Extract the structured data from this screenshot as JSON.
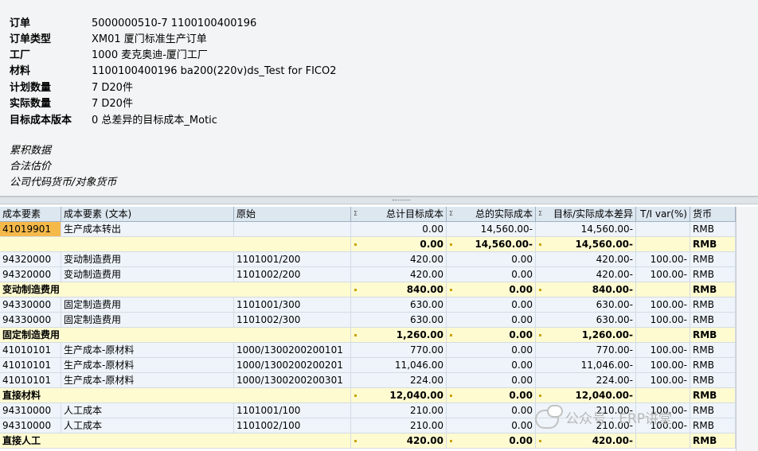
{
  "order_info": {
    "rows": [
      {
        "label": "订单",
        "value": "5000000510-7 1100100400196"
      },
      {
        "label": "订单类型",
        "value": "XM01 厦门标准生产订单"
      },
      {
        "label": "工厂",
        "value": "1000 麦克奥迪-厦门工厂"
      },
      {
        "label": "材料",
        "value": "1100100400196 ba200(220v)ds_Test for FICO2"
      },
      {
        "label": "计划数量",
        "value": "7 D20件"
      },
      {
        "label": "实际数量",
        "value": "7 D20件"
      },
      {
        "label": "目标成本版本",
        "value": "0 总差异的目标成本_Motic"
      }
    ],
    "notes": [
      "累积数据",
      "合法估价",
      "公司代码货币/对象货币"
    ]
  },
  "table": {
    "columns": [
      "成本要素",
      "成本要素 (文本)",
      "原始",
      "总计目标成本",
      "总的实际成本",
      "目标/实际成本差异",
      "T/I var(%)",
      "货币"
    ],
    "rows": [
      {
        "type": "detail",
        "selected": true,
        "cells": [
          "41019901",
          "生产成本转出",
          "",
          "0.00",
          "14,560.00-",
          "14,560.00-",
          "",
          "RMB"
        ]
      },
      {
        "type": "total",
        "cells": [
          "",
          "",
          "",
          "0.00",
          "14,560.00-",
          "14,560.00-",
          "",
          "RMB"
        ]
      },
      {
        "type": "detail",
        "cells": [
          "94320000",
          "变动制造费用",
          "1101001/200",
          "420.00",
          "0.00",
          "420.00-",
          "100.00-",
          "RMB"
        ]
      },
      {
        "type": "detail",
        "cells": [
          "94320000",
          "变动制造费用",
          "1101002/200",
          "420.00",
          "0.00",
          "420.00-",
          "100.00-",
          "RMB"
        ]
      },
      {
        "type": "total",
        "cells": [
          "变动制造费用",
          "",
          "",
          "840.00",
          "0.00",
          "840.00-",
          "",
          "RMB"
        ]
      },
      {
        "type": "detail",
        "cells": [
          "94330000",
          "固定制造费用",
          "1101001/300",
          "630.00",
          "0.00",
          "630.00-",
          "100.00-",
          "RMB"
        ]
      },
      {
        "type": "detail",
        "cells": [
          "94330000",
          "固定制造费用",
          "1101002/300",
          "630.00",
          "0.00",
          "630.00-",
          "100.00-",
          "RMB"
        ]
      },
      {
        "type": "total",
        "cells": [
          "固定制造费用",
          "",
          "",
          "1,260.00",
          "0.00",
          "1,260.00-",
          "",
          "RMB"
        ]
      },
      {
        "type": "detail",
        "cells": [
          "41010101",
          "生产成本-原材料",
          "1000/1300200200101",
          "770.00",
          "0.00",
          "770.00-",
          "100.00-",
          "RMB"
        ]
      },
      {
        "type": "detail",
        "cells": [
          "41010101",
          "生产成本-原材料",
          "1000/1300200200201",
          "11,046.00",
          "0.00",
          "11,046.00-",
          "100.00-",
          "RMB"
        ]
      },
      {
        "type": "detail",
        "cells": [
          "41010101",
          "生产成本-原材料",
          "1000/1300200200301",
          "224.00",
          "0.00",
          "224.00-",
          "100.00-",
          "RMB"
        ]
      },
      {
        "type": "total",
        "cells": [
          "直接材料",
          "",
          "",
          "12,040.00",
          "0.00",
          "12,040.00-",
          "",
          "RMB"
        ]
      },
      {
        "type": "detail",
        "cells": [
          "94310000",
          "人工成本",
          "1101001/100",
          "210.00",
          "0.00",
          "210.00-",
          "100.00-",
          "RMB"
        ]
      },
      {
        "type": "detail",
        "cells": [
          "94310000",
          "人工成本",
          "1101002/100",
          "210.00",
          "0.00",
          "210.00-",
          "100.00-",
          "RMB"
        ]
      },
      {
        "type": "total",
        "cells": [
          "直接人工",
          "",
          "",
          "420.00",
          "0.00",
          "420.00-",
          "",
          "RMB"
        ]
      }
    ]
  },
  "watermark": "公众号 · ERP讲堂"
}
